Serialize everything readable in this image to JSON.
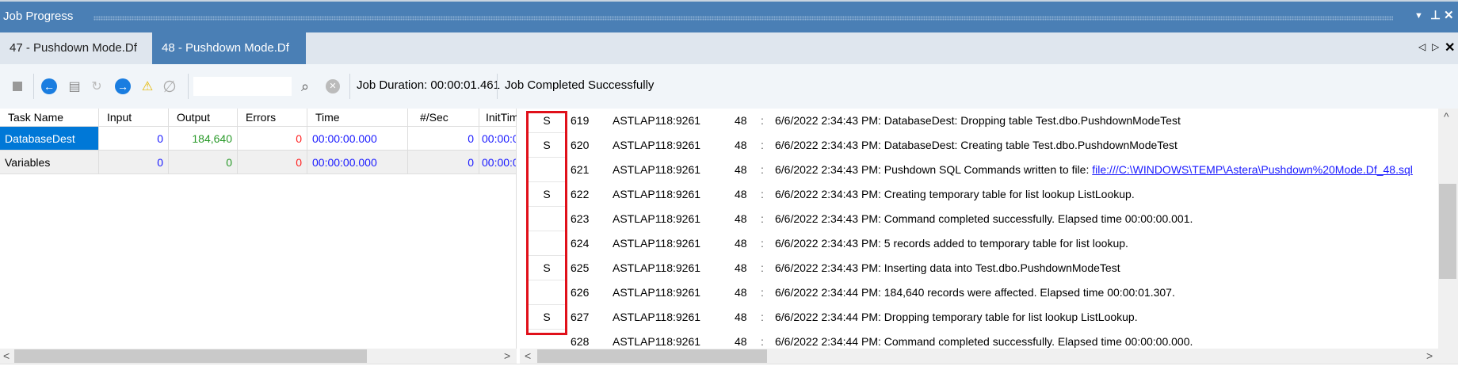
{
  "window": {
    "title": "Job Progress",
    "icons": [
      "dropdown-icon",
      "pin-icon",
      "close-icon"
    ]
  },
  "tabs": [
    {
      "label": "47 - Pushdown Mode.Df",
      "active": false
    },
    {
      "label": "48 - Pushdown Mode.Df",
      "active": true
    }
  ],
  "toolbar": {
    "search_value": "",
    "job_duration": "Job Duration: 00:00:01.461",
    "job_status": "Job Completed Successfully"
  },
  "task_grid": {
    "headers": [
      "Task Name",
      "Input",
      "Output",
      "Errors",
      "Time",
      "#/Sec",
      "InitTim"
    ],
    "rows": [
      {
        "name": "DatabaseDest",
        "input": "0",
        "output": "184,640",
        "errors": "0",
        "time": "00:00:00.000",
        "per_sec": "0",
        "init": "00:00:0"
      },
      {
        "name": "Variables",
        "input": "0",
        "output": "0",
        "errors": "0",
        "time": "00:00:00.000",
        "per_sec": "0",
        "init": "00:00:0"
      }
    ]
  },
  "log": [
    {
      "flag": "S",
      "id": "619",
      "host": "ASTLAP118:9261",
      "job": "48",
      "sep": ":",
      "msg": "6/6/2022 2:34:43 PM: DatabaseDest: Dropping table Test.dbo.PushdownModeTest"
    },
    {
      "flag": "S",
      "id": "620",
      "host": "ASTLAP118:9261",
      "job": "48",
      "sep": ":",
      "msg": "6/6/2022 2:34:43 PM: DatabaseDest: Creating table Test.dbo.PushdownModeTest"
    },
    {
      "flag": "",
      "id": "621",
      "host": "ASTLAP118:9261",
      "job": "48",
      "sep": ":",
      "msg": "6/6/2022 2:34:43 PM: Pushdown SQL Commands written to file: ",
      "link": "file:///C:\\WINDOWS\\TEMP\\Astera\\Pushdown%20Mode.Df_48.sql"
    },
    {
      "flag": "S",
      "id": "622",
      "host": "ASTLAP118:9261",
      "job": "48",
      "sep": ":",
      "msg": "6/6/2022 2:34:43 PM: Creating temporary table for list lookup ListLookup."
    },
    {
      "flag": "",
      "id": "623",
      "host": "ASTLAP118:9261",
      "job": "48",
      "sep": ":",
      "msg": "6/6/2022 2:34:43 PM: Command completed successfully. Elapsed time 00:00:00.001."
    },
    {
      "flag": "",
      "id": "624",
      "host": "ASTLAP118:9261",
      "job": "48",
      "sep": ":",
      "msg": "6/6/2022 2:34:43 PM: 5 records added to temporary table for list lookup."
    },
    {
      "flag": "S",
      "id": "625",
      "host": "ASTLAP118:9261",
      "job": "48",
      "sep": ":",
      "msg": "6/6/2022 2:34:43 PM: Inserting data into Test.dbo.PushdownModeTest"
    },
    {
      "flag": "",
      "id": "626",
      "host": "ASTLAP118:9261",
      "job": "48",
      "sep": ":",
      "msg": "6/6/2022 2:34:44 PM: 184,640 records were affected. Elapsed time 00:00:01.307."
    },
    {
      "flag": "S",
      "id": "627",
      "host": "ASTLAP118:9261",
      "job": "48",
      "sep": ":",
      "msg": "6/6/2022 2:34:44 PM: Dropping temporary table for list lookup ListLookup."
    },
    {
      "flag": "",
      "id": "628",
      "host": "ASTLAP118:9261",
      "job": "48",
      "sep": ":",
      "msg": "6/6/2022 2:34:44 PM: Command completed successfully. Elapsed time 00:00:00.000."
    }
  ],
  "colors": {
    "title_bar": "#4a7fb5",
    "selected_cell": "#0078d7",
    "input": "#1a1aff",
    "output": "#2a9a2a",
    "errors": "#ff2020",
    "highlight_box": "#e0101a"
  }
}
